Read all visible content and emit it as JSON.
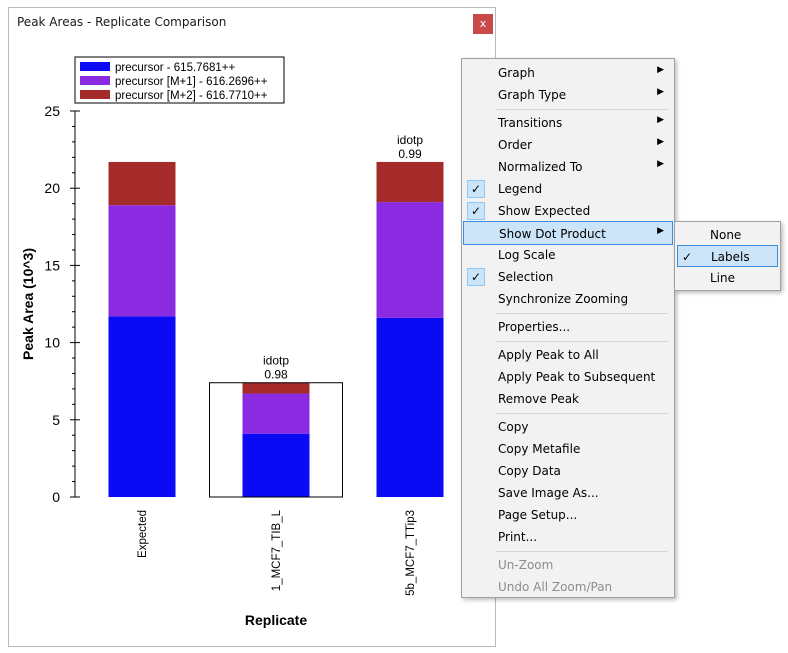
{
  "window": {
    "title": "Peak Areas - Replicate Comparison",
    "close_label": "x"
  },
  "chart_data": {
    "type": "bar",
    "stacked": true,
    "categories": [
      "Expected",
      "1_MCF7_TIB_L",
      "5b_MCF7_TTip3"
    ],
    "series": [
      {
        "name": "precursor - 615.7681++",
        "color": "#0a0af5",
        "values": [
          11.7,
          4.1,
          11.6
        ]
      },
      {
        "name": "precursor [M+1] - 616.2696++",
        "color": "#8a2be2",
        "values": [
          7.2,
          2.6,
          7.5
        ]
      },
      {
        "name": "precursor [M+2] - 616.7710++",
        "color": "#a52a2a",
        "values": [
          2.8,
          0.7,
          2.6
        ]
      }
    ],
    "expected_outline": {
      "category": "1_MCF7_TIB_L",
      "value": 7.4
    },
    "dot_labels": [
      {
        "category": "1_MCF7_TIB_L",
        "line1": "idotp",
        "line2": "0.98"
      },
      {
        "category": "5b_MCF7_TTip3",
        "line1": "idotp",
        "line2": "0.99"
      }
    ],
    "xlabel": "Replicate",
    "ylabel": "Peak Area (10^3)",
    "ylim": [
      0,
      25
    ],
    "yticks": [
      "0",
      "5",
      "10",
      "15",
      "20",
      "25"
    ],
    "legend_position": "top-left"
  },
  "context_menu": {
    "items": [
      {
        "label": "Graph",
        "submenu": true
      },
      {
        "label": "Graph Type",
        "submenu": true
      },
      {
        "label": "Transitions",
        "submenu": true
      },
      {
        "label": "Order",
        "submenu": true
      },
      {
        "label": "Normalized To",
        "submenu": true
      },
      {
        "label": "Legend",
        "checked": true
      },
      {
        "label": "Show Expected",
        "checked": true
      },
      {
        "label": "Show Dot Product",
        "submenu": true,
        "highlighted": true
      },
      {
        "label": "Log Scale"
      },
      {
        "label": "Selection",
        "checked": true
      },
      {
        "label": "Synchronize Zooming"
      },
      {
        "label": "Properties..."
      },
      {
        "label": "Apply Peak to All"
      },
      {
        "label": "Apply Peak to Subsequent"
      },
      {
        "label": "Remove Peak"
      },
      {
        "label": "Copy"
      },
      {
        "label": "Copy Metafile"
      },
      {
        "label": "Copy Data"
      },
      {
        "label": "Save Image As..."
      },
      {
        "label": "Page Setup..."
      },
      {
        "label": "Print..."
      },
      {
        "label": "Un-Zoom",
        "disabled": true
      },
      {
        "label": "Undo All Zoom/Pan",
        "disabled": true
      }
    ],
    "submenu": {
      "items": [
        {
          "label": "None"
        },
        {
          "label": "Labels",
          "checked": true,
          "highlighted": true
        },
        {
          "label": "Line"
        }
      ]
    }
  }
}
